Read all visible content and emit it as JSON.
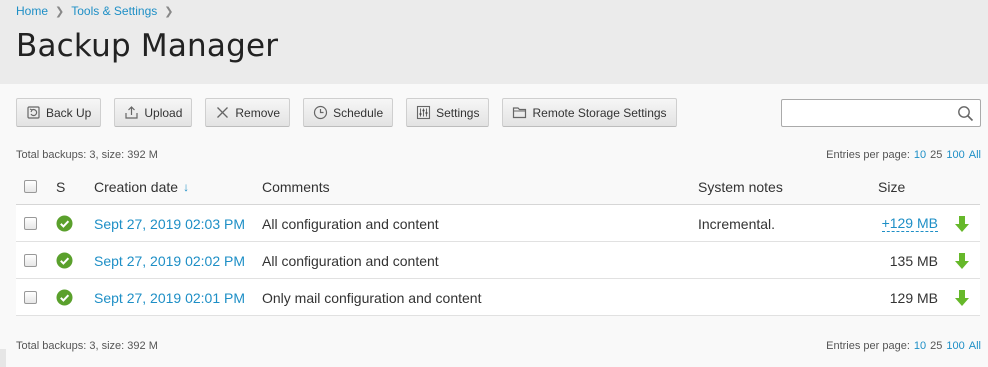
{
  "breadcrumb": [
    "Home",
    "Tools & Settings"
  ],
  "title": "Backup Manager",
  "toolbar": {
    "backup": "Back Up",
    "upload": "Upload",
    "remove": "Remove",
    "schedule": "Schedule",
    "settings": "Settings",
    "remote": "Remote Storage Settings"
  },
  "search": {
    "value": "",
    "placeholder": ""
  },
  "summary_text": "Total backups: 3, size: 392 M",
  "per_page": {
    "label": "Entries per page:",
    "options": [
      "10",
      "25",
      "100",
      "All"
    ],
    "selected": "25"
  },
  "table": {
    "columns": {
      "status": "S",
      "date": "Creation date",
      "sort_indicator": "↓",
      "comments": "Comments",
      "notes": "System notes",
      "size": "Size"
    },
    "rows": [
      {
        "date": "Sept 27, 2019 02:03 PM",
        "comments": "All configuration and content",
        "notes": "Incremental.",
        "size": "+129 MB",
        "size_is_link": true
      },
      {
        "date": "Sept 27, 2019 02:02 PM",
        "comments": "All configuration and content",
        "notes": "",
        "size": "135 MB",
        "size_is_link": false
      },
      {
        "date": "Sept 27, 2019 02:01 PM",
        "comments": "Only mail configuration and content",
        "notes": "",
        "size": "129 MB",
        "size_is_link": false
      }
    ]
  },
  "icons": {
    "status": "check-circle-icon",
    "download": "download-arrow-icon"
  },
  "colors": {
    "link": "#1e8fc6",
    "status_ok": "#5aa02c",
    "download": "#66b82a"
  }
}
